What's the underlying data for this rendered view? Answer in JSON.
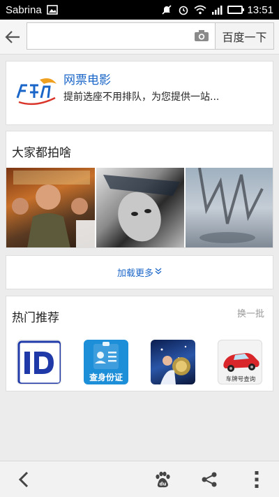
{
  "status_bar": {
    "carrier": "Sabrina",
    "time": "13:51"
  },
  "search": {
    "placeholder": "",
    "value": "",
    "button_label": "百度一下"
  },
  "ad": {
    "title": "网票电影",
    "description": "提前选座不用排队，为您提供一站...",
    "logo_text": "网票网"
  },
  "movies": {
    "title": "大家都拍啥",
    "load_more": "加载更多",
    "posters": [
      "movie-poster-1",
      "movie-poster-2",
      "movie-poster-3"
    ]
  },
  "hot": {
    "title": "热门推荐",
    "swap_label": "换一批",
    "apps": [
      {
        "name": "id-app",
        "label": ""
      },
      {
        "name": "id-check-app",
        "label": "查身份证"
      },
      {
        "name": "zodiac-app",
        "label": ""
      },
      {
        "name": "car-plate-app",
        "label": "车牌号查询"
      }
    ]
  },
  "colors": {
    "link_blue": "#1a66c8",
    "status_bar": "#000000",
    "battery_green": "#3ddc3d"
  }
}
